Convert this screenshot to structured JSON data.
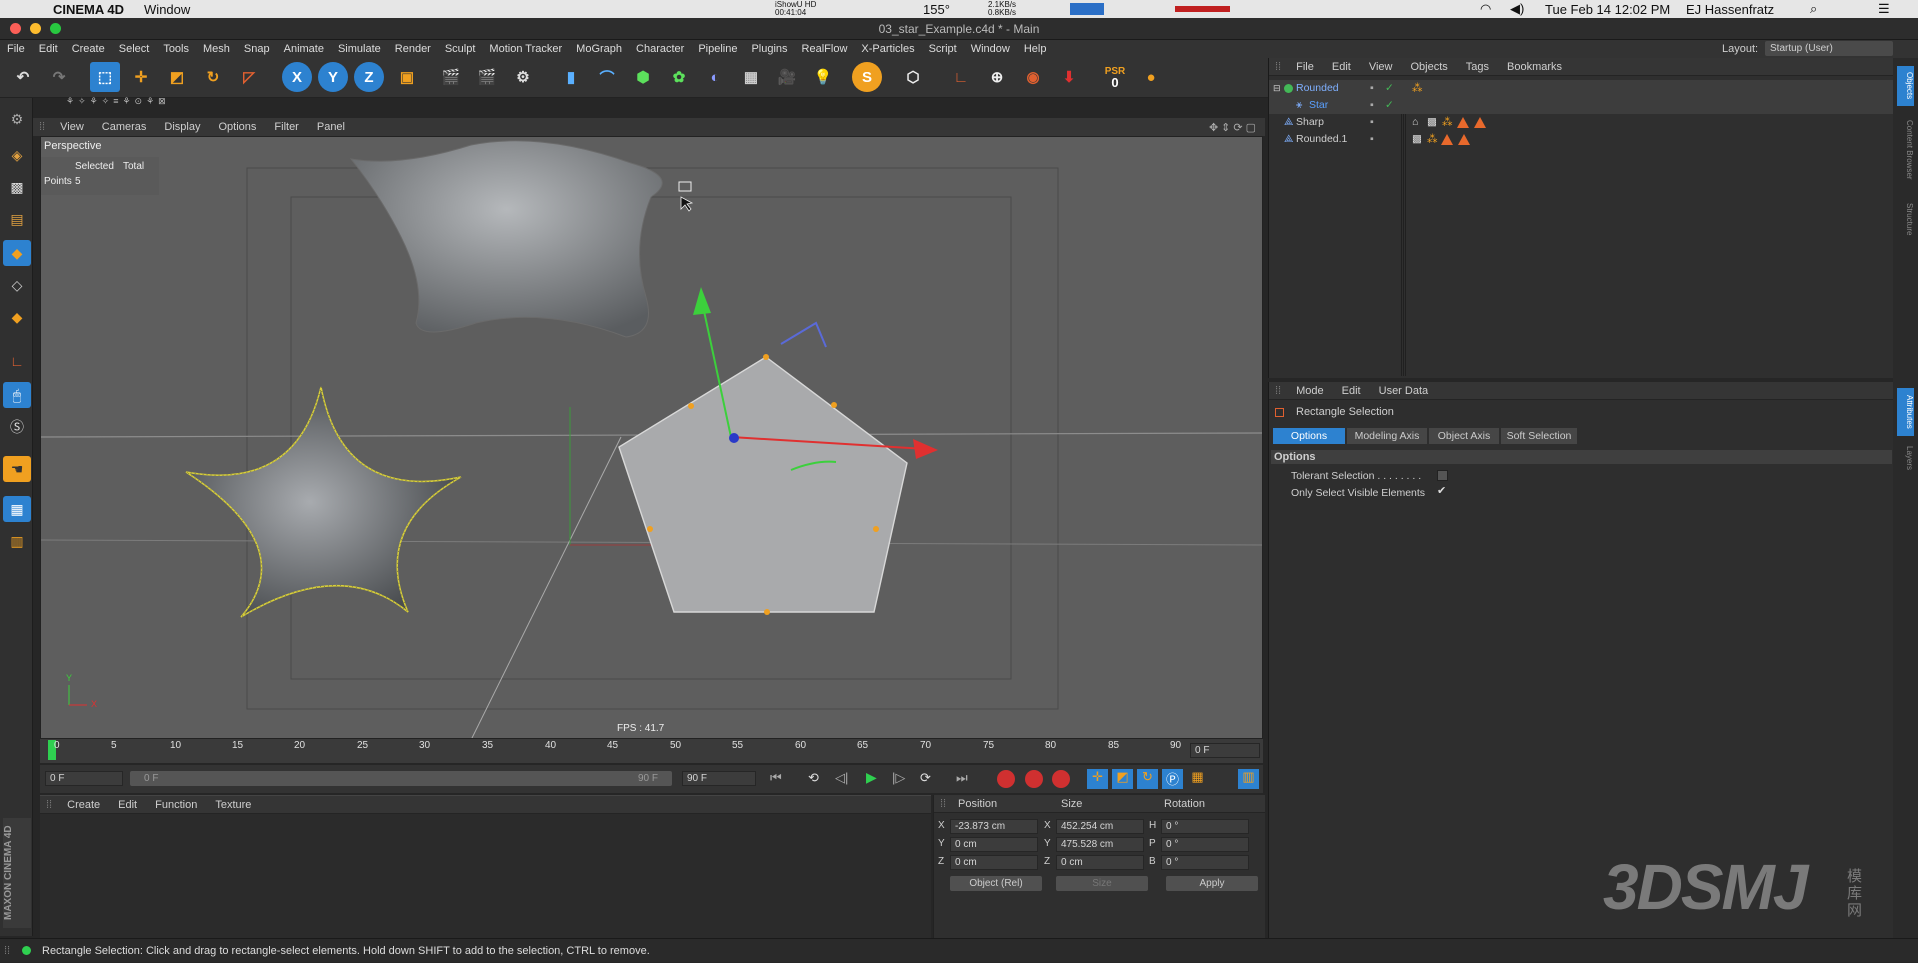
{
  "mac": {
    "apple": "",
    "app": "CINEMA 4D",
    "window_menu": "Window",
    "datetime": "Tue Feb 14  12:02 PM",
    "user": "EJ Hassenfratz",
    "temp": "155°",
    "net": "2.1KB/s 0.8KB/s",
    "recorder": "iShowU HD 00:41:04"
  },
  "window": {
    "title": "03_star_Example.c4d * - Main"
  },
  "menus": [
    "File",
    "Edit",
    "Create",
    "Select",
    "Tools",
    "Mesh",
    "Snap",
    "Animate",
    "Simulate",
    "Render",
    "Sculpt",
    "Motion Tracker",
    "MoGraph",
    "Character",
    "Pipeline",
    "Plugins",
    "RealFlow",
    "X-Particles",
    "Script",
    "Window",
    "Help"
  ],
  "layout": {
    "label": "Layout:",
    "value": "Startup (User)"
  },
  "toolbar": {
    "x": "X",
    "y": "Y",
    "z": "Z",
    "psr": "PSR",
    "psr_val": "0",
    "snap_icon": "S"
  },
  "viewport": {
    "menu": [
      "View",
      "Cameras",
      "Display",
      "Options",
      "Filter",
      "Panel"
    ],
    "name": "Perspective",
    "stats": {
      "selected_label": "Selected",
      "total_label": "Total",
      "points_label": "Points",
      "points_selected": "5"
    },
    "fps": "FPS : 41.7",
    "axis_y": "Y",
    "axis_x": "X"
  },
  "timeline": {
    "ticks": [
      "0",
      "5",
      "10",
      "15",
      "20",
      "25",
      "30",
      "35",
      "40",
      "45",
      "50",
      "55",
      "60",
      "65",
      "70",
      "75",
      "80",
      "85",
      "90"
    ],
    "current": "0 F"
  },
  "transport": {
    "start": "0 F",
    "range_start": "0 F",
    "range_end": "90 F",
    "end": "90 F"
  },
  "material_panel": {
    "menu": [
      "Create",
      "Edit",
      "Function",
      "Texture"
    ]
  },
  "coords": {
    "headers": [
      "Position",
      "Size",
      "Rotation"
    ],
    "rows": [
      {
        "axis": "X",
        "pos": "-23.873 cm",
        "size_axis": "X",
        "size": "452.254 cm",
        "rot_axis": "H",
        "rot": "0 °"
      },
      {
        "axis": "Y",
        "pos": "0 cm",
        "size_axis": "Y",
        "size": "475.528 cm",
        "rot_axis": "P",
        "rot": "0 °"
      },
      {
        "axis": "Z",
        "pos": "0 cm",
        "size_axis": "Z",
        "size": "0 cm",
        "rot_axis": "B",
        "rot": "0 °"
      }
    ],
    "mode": "Object (Rel)",
    "size_mode": "Size",
    "apply": "Apply"
  },
  "objects": {
    "menu": [
      "File",
      "Edit",
      "View",
      "Objects",
      "Tags",
      "Bookmarks"
    ],
    "items": [
      {
        "name": "Rounded",
        "level": 0
      },
      {
        "name": "Star",
        "level": 1
      },
      {
        "name": "Sharp",
        "level": 0
      },
      {
        "name": "Rounded.1",
        "level": 0
      }
    ]
  },
  "attributes": {
    "menu": [
      "Mode",
      "Edit",
      "User Data"
    ],
    "title": "Rectangle Selection",
    "tabs": [
      "Options",
      "Modeling Axis",
      "Object Axis",
      "Soft Selection"
    ],
    "section": "Options",
    "opt1": "Tolerant Selection . . . . . . . .",
    "opt2": "Only Select Visible Elements",
    "opt2_check": "✔"
  },
  "right_tabs": [
    "Objects",
    "Content Browser",
    "Structure",
    "Attributes",
    "Layers"
  ],
  "status": "Rectangle Selection: Click and drag to rectangle-select elements. Hold down SHIFT to add to the selection, CTRL to remove.",
  "maxon": "MAXON CINEMA 4D",
  "watermark": "3DSMJ",
  "watermark_cn": "模 库 网",
  "colors": {
    "accent": "#2d82d0",
    "selected_obj": "#5aa0ff"
  }
}
